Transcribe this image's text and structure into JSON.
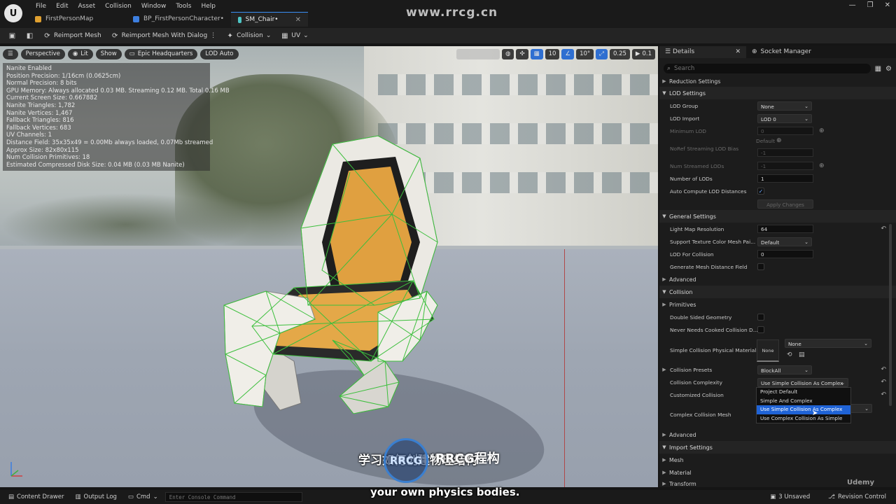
{
  "app": {
    "logo": "U",
    "menu": [
      "File",
      "Edit",
      "Asset",
      "Collision",
      "Window",
      "Tools",
      "Help"
    ],
    "tabs": [
      {
        "label": "FirstPersonMap",
        "active": false
      },
      {
        "label": "BP_FirstPersonCharacter•",
        "active": false
      },
      {
        "label": "SM_Chair•",
        "active": true
      }
    ],
    "watermark": "www.rrcg.cn",
    "window_controls": [
      "—",
      "❐",
      "✕"
    ]
  },
  "toolbar": {
    "reimport": "Reimport Mesh",
    "reimport_dialog": "Reimport Mesh With Dialog",
    "collision": "Collision",
    "uv": "UV"
  },
  "viewport": {
    "buttons": {
      "perspective": "Perspective",
      "lit": "Lit",
      "show": "Show",
      "scalability": "Epic Headquarters",
      "lod": "LOD Auto"
    },
    "right_chips": {
      "grid": "10",
      "rot": "10°",
      "scale": "0.25",
      "cam": "0.1"
    },
    "stats": [
      "Nanite Enabled",
      "Position Precision: 1/16cm (0.0625cm)",
      "Normal Precision: 8 bits",
      "GPU Memory: Always allocated 0.03 MB. Streaming 0.12 MB. Total 0.16 MB",
      "Current Screen Size: 0.667882",
      "Nanite Triangles: 1,782",
      "Nanite Vertices: 1,467",
      "Fallback Triangles: 816",
      "Fallback Vertices: 683",
      "UV Channels: 1",
      "Distance Field: 35x35x49 = 0.00Mb always loaded, 0.07Mb streamed",
      "Approx Size: 82x80x115",
      "Num Collision Primitives: 18",
      "Estimated Compressed Disk Size: 0.04 MB (0.03 MB Nanite)"
    ]
  },
  "subtitles": {
    "cn": "学习如何创建物理结构",
    "logo_text": "RRCG",
    "word": "RRCG程构",
    "en": "your own physics bodies."
  },
  "details": {
    "tabs": {
      "details": "Details",
      "socket": "Socket Manager"
    },
    "search_placeholder": "Search",
    "reduction": "Reduction Settings",
    "lod_settings": "LOD Settings",
    "lod_group": {
      "label": "LOD Group",
      "value": "None"
    },
    "lod_import": {
      "label": "LOD Import",
      "value": "LOD 0"
    },
    "minimum_lod": {
      "label": "Minimum LOD",
      "value": "0"
    },
    "default_label": "Default",
    "noref": {
      "label": "NoRef Streaming LOD Bias",
      "value": "-1"
    },
    "num_streamed": {
      "label": "Num Streamed LODs",
      "value": "-1"
    },
    "num_lods": {
      "label": "Number of LODs",
      "value": "1"
    },
    "auto_compute": {
      "label": "Auto Compute LOD Distances"
    },
    "apply": "Apply Changes",
    "general": "General Settings",
    "light_map": {
      "label": "Light Map Resolution",
      "value": "64"
    },
    "support_tex": {
      "label": "Support Texture Color Mesh Pai...",
      "value": "Default"
    },
    "lod_collision": {
      "label": "LOD For Collision",
      "value": "0"
    },
    "gen_mesh_df": {
      "label": "Generate Mesh Distance Field"
    },
    "advanced": "Advanced",
    "collision": "Collision",
    "primitives": "Primitives",
    "double_sided": {
      "label": "Double Sided Geometry"
    },
    "never_cooked": {
      "label": "Never Needs Cooked Collision D..."
    },
    "simple_phys_mat": {
      "label": "Simple Collision Physical Material",
      "thumb": "None",
      "value": "None"
    },
    "presets": {
      "label": "Collision Presets",
      "value": "BlockAll"
    },
    "complexity": {
      "label": "Collision Complexity",
      "value": "Use Simple Collision As Complex"
    },
    "customized": {
      "label": "Customized Collision"
    },
    "complex_mesh": {
      "label": "Complex Collision Mesh"
    },
    "dropdown_options": [
      {
        "label": "Project Default",
        "selected": false
      },
      {
        "label": "Simple And Complex",
        "selected": false
      },
      {
        "label": "Use Simple Collision As Complex",
        "selected": true
      },
      {
        "label": "Use Complex Collision As Simple",
        "selected": false
      }
    ],
    "advanced2": "Advanced",
    "import": "Import Settings",
    "mesh": "Mesh",
    "material": "Material",
    "transform": "Transform"
  },
  "statusbar": {
    "content_drawer": "Content Drawer",
    "output_log": "Output Log",
    "cmd": "Cmd",
    "console_placeholder": "Enter Console Command",
    "unsaved": "3 Unsaved",
    "revision": "Revision Control",
    "udemy": "Udemy"
  },
  "colors": {
    "accent": "#1f63d6",
    "collision_wire": "#3cbf3c",
    "seat": "#e0a040"
  }
}
